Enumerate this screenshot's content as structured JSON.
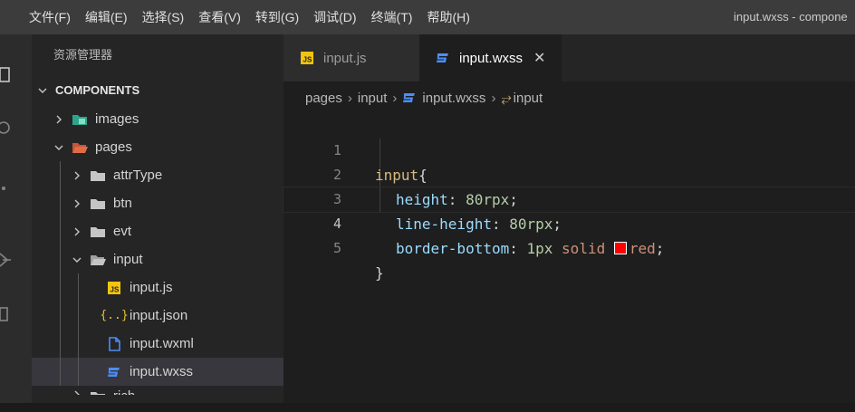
{
  "menu": [
    "文件(F)",
    "编辑(E)",
    "选择(S)",
    "查看(V)",
    "转到(G)",
    "调试(D)",
    "终端(T)",
    "帮助(H)"
  ],
  "window_title": "input.wxss - components",
  "sidebar": {
    "title": "资源管理器",
    "section": "COMPONENTS",
    "tree": {
      "images": "images",
      "pages": "pages",
      "attrType": "attrType",
      "btn": "btn",
      "evt": "evt",
      "input": "input",
      "input_js": "input.js",
      "input_json": "input.json",
      "input_wxml": "input.wxml",
      "input_wxss": "input.wxss",
      "rich": "rich"
    }
  },
  "tabs": [
    {
      "label": "input.js",
      "icon": "js-file-icon",
      "active": false
    },
    {
      "label": "input.wxss",
      "icon": "css-file-icon",
      "active": true
    }
  ],
  "breadcrumb": {
    "pages": "pages",
    "input": "input",
    "file": "input.wxss",
    "symbol": "input"
  },
  "editor": {
    "line_numbers": [
      "1",
      "2",
      "3",
      "4",
      "5"
    ],
    "current_line": 4,
    "code": {
      "l1_selector": "input",
      "l1_brace": "{",
      "l2_prop": "height",
      "l2_val": "80rpx",
      "l3_prop": "line-height",
      "l3_val": "80rpx",
      "l4_prop": "border-bottom",
      "l4_num": "1px",
      "l4_kw": "solid",
      "l4_color": "red",
      "l5_brace": "}"
    }
  },
  "colors": {
    "js_icon": "#f1c40f",
    "css_icon": "#4c8df6",
    "folder_gray": "#c5c5c5",
    "pages_folder": "#e06c44",
    "images_folder": "#2fa38a",
    "swatch_red": "#ff0000"
  }
}
